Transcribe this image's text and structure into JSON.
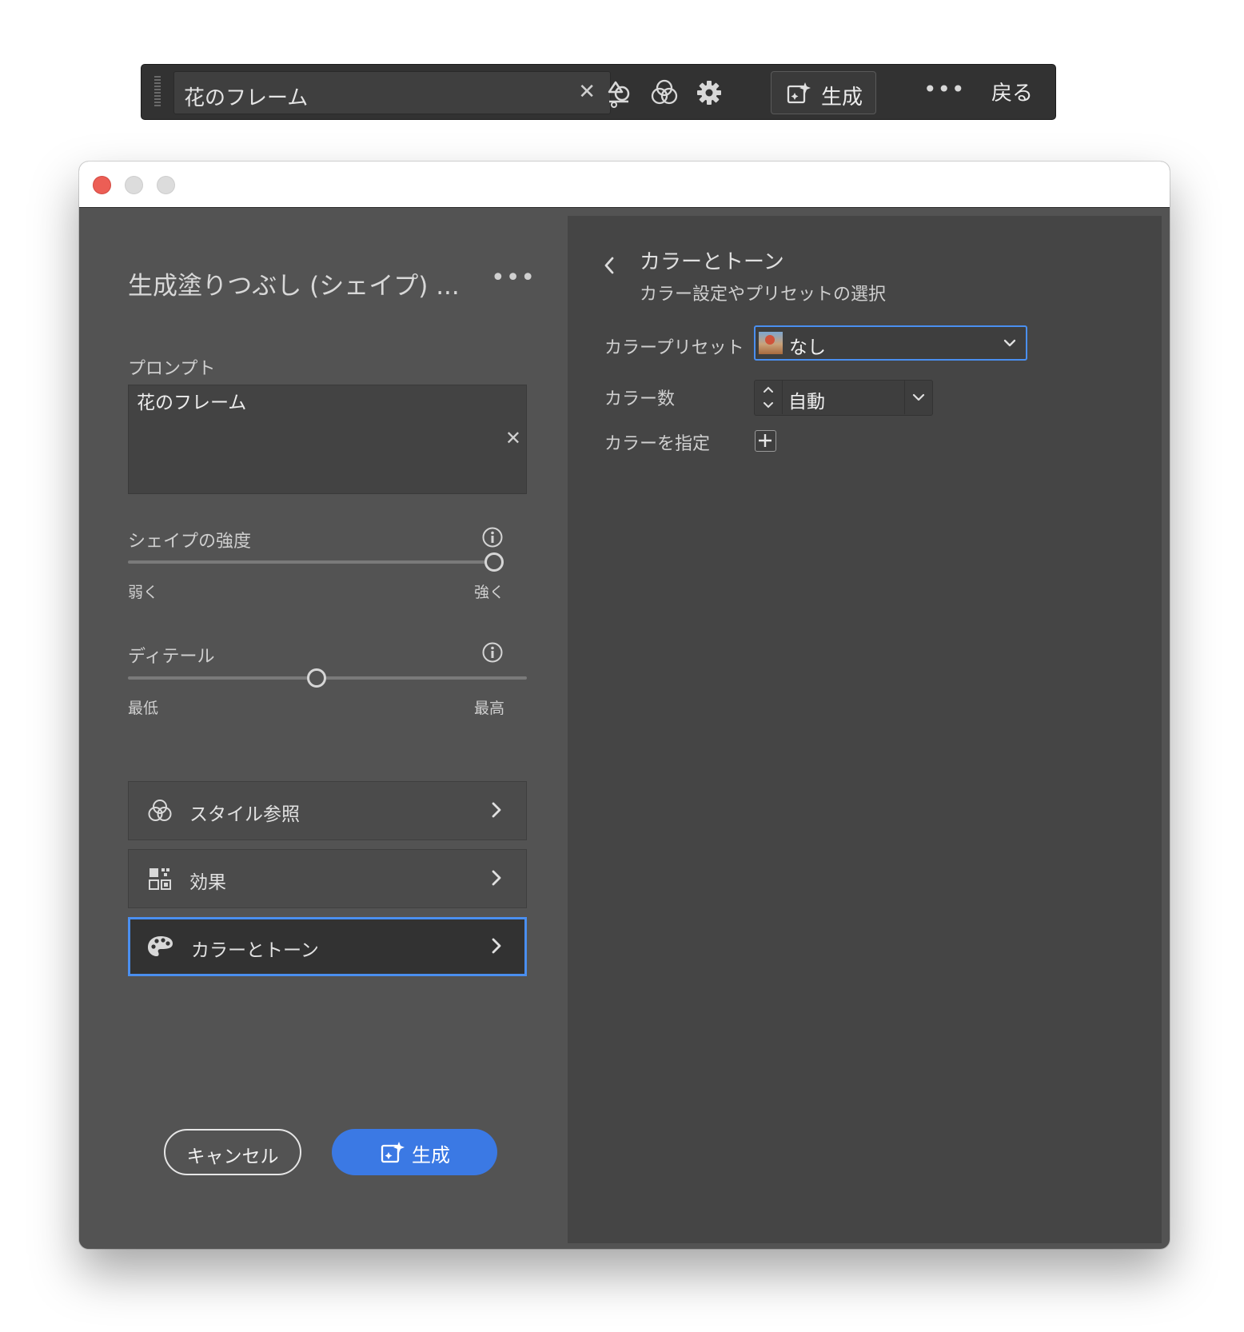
{
  "taskbar": {
    "field_value": "花のフレーム",
    "generate_label": "生成",
    "more_label": "•••",
    "back_label": "戻る"
  },
  "panel": {
    "title": "生成塗りつぶし (シェイプ) ...",
    "more_label": "•••",
    "prompt_label": "プロンプト",
    "prompt_value": "花のフレーム",
    "shape_strength": {
      "label": "シェイプの強度",
      "min_label": "弱く",
      "max_label": "強く",
      "value": 1.0
    },
    "detail": {
      "label": "ディテール",
      "min_label": "最低",
      "max_label": "最高",
      "value": 0.5
    },
    "nav": [
      {
        "label": "スタイル参照",
        "icon": "style-reference-icon"
      },
      {
        "label": "効果",
        "icon": "effects-icon"
      },
      {
        "label": "カラーとトーン",
        "icon": "palette-icon",
        "selected": true
      }
    ],
    "cancel_label": "キャンセル",
    "generate_label": "生成"
  },
  "color_tone": {
    "title": "カラーとトーン",
    "subtitle": "カラー設定やプリセットの選択",
    "preset_label": "カラープリセット",
    "preset_value": "なし",
    "count_label": "カラー数",
    "count_value": "自動",
    "specify_label": "カラーを指定"
  },
  "colors": {
    "accent": "#3b79e4",
    "selection_border": "#4a8ff0",
    "panel_bg": "#535353",
    "subpanel_bg": "#454545"
  }
}
